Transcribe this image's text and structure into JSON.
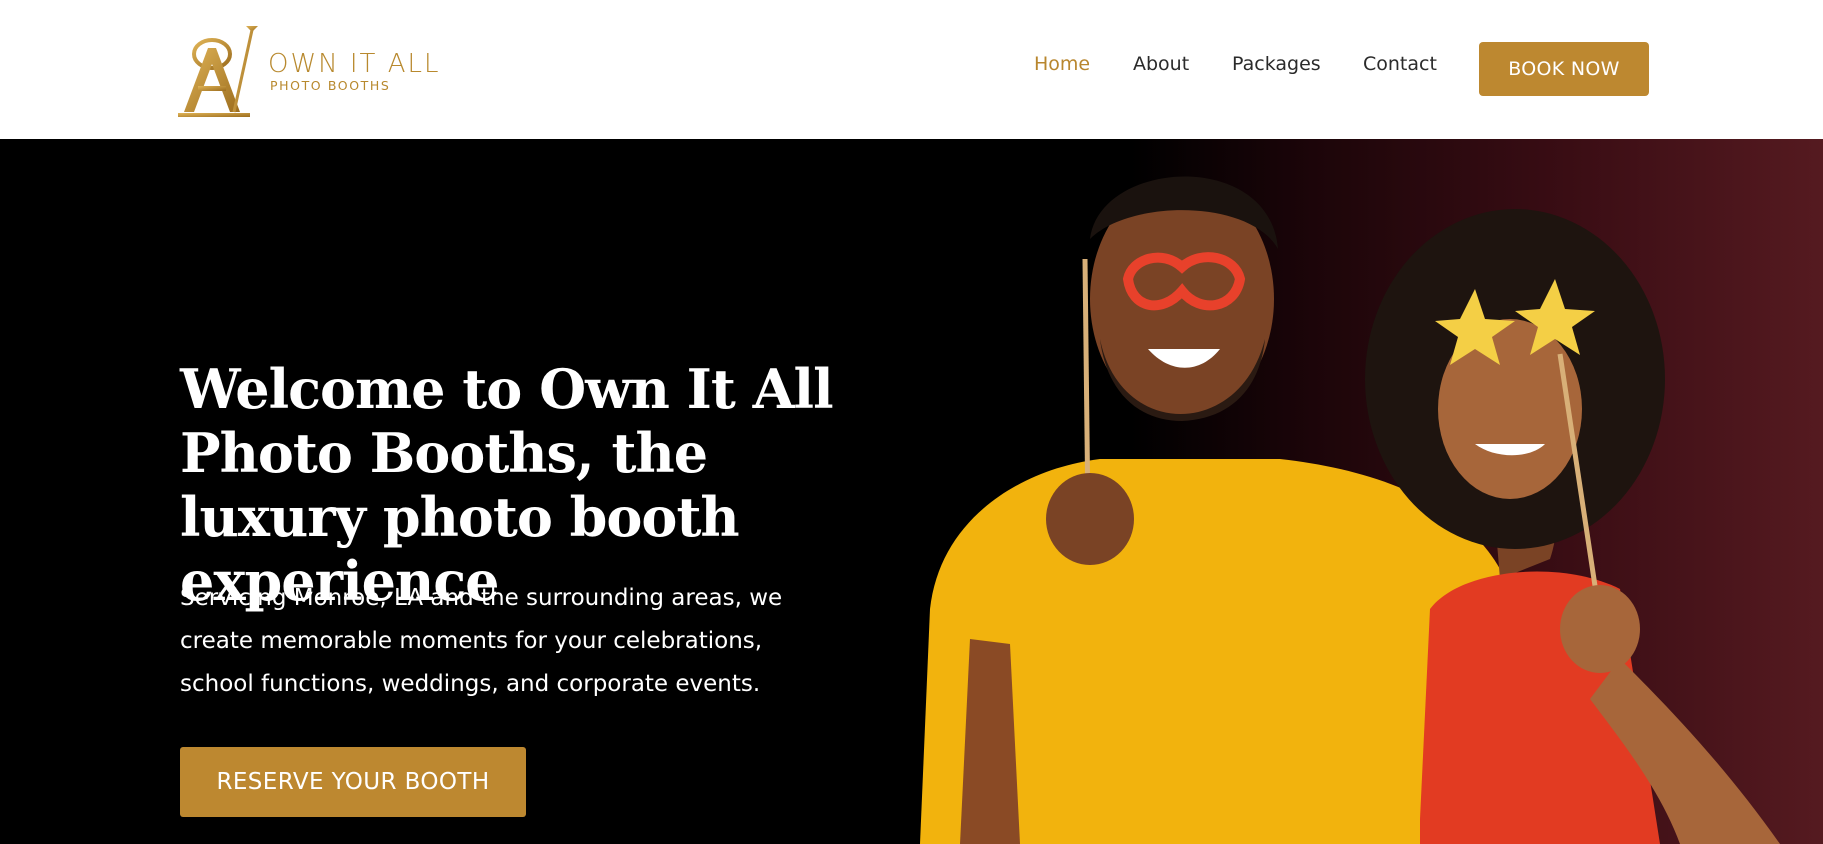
{
  "brand": {
    "logo_monogram": "OA",
    "name": "OWN IT ALL",
    "subtitle": "PHOTO BOOTHS",
    "accent_color": "#bd8830"
  },
  "nav": {
    "items": [
      {
        "label": "Home",
        "active": true
      },
      {
        "label": "About",
        "active": false
      },
      {
        "label": "Packages",
        "active": false
      },
      {
        "label": "Contact",
        "active": false
      }
    ],
    "cta_label": "BOOK NOW"
  },
  "hero": {
    "title": "Welcome to Own It All Photo Booths, the luxury photo booth experience",
    "description": "Servicing Monroe, LA and the surrounding areas, we create memorable moments for your celebrations, school functions, weddings, and corporate events.",
    "cta_label": "RESERVE YOUR BOOTH",
    "image": "couple-with-photo-booth-props"
  }
}
